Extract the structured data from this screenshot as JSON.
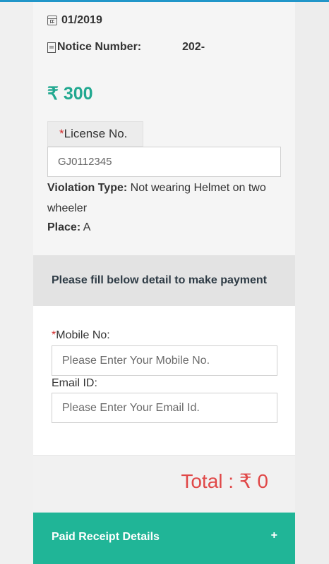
{
  "challan": {
    "date": "01/2019",
    "notice_label": "Notice Number:",
    "notice_value": "202-",
    "amount": "₹ 300",
    "license_label": "License No.",
    "license_required": "*",
    "license_value": "GJ0112345",
    "violation_label": "Violation Type:",
    "violation_value": "Not wearing Helmet on two wheeler",
    "place_label": "Place:",
    "place_value": "A"
  },
  "payment": {
    "banner": "Please fill below detail to make payment",
    "mobile_required": "*",
    "mobile_label": "Mobile No:",
    "mobile_placeholder": "Please Enter Your Mobile No.",
    "email_label": "Email ID:",
    "email_placeholder": "Please Enter Your Email Id.",
    "total": "Total : ₹ 0"
  },
  "receipt": {
    "label": "Paid Receipt Details",
    "toggle": "+"
  },
  "icons": {
    "date": "calendar-icon",
    "notice": "document-icon"
  },
  "colors": {
    "accent_green": "#20b597",
    "amount_green": "#21a890",
    "total_red": "#e04848",
    "required_red": "#d32f2f"
  }
}
